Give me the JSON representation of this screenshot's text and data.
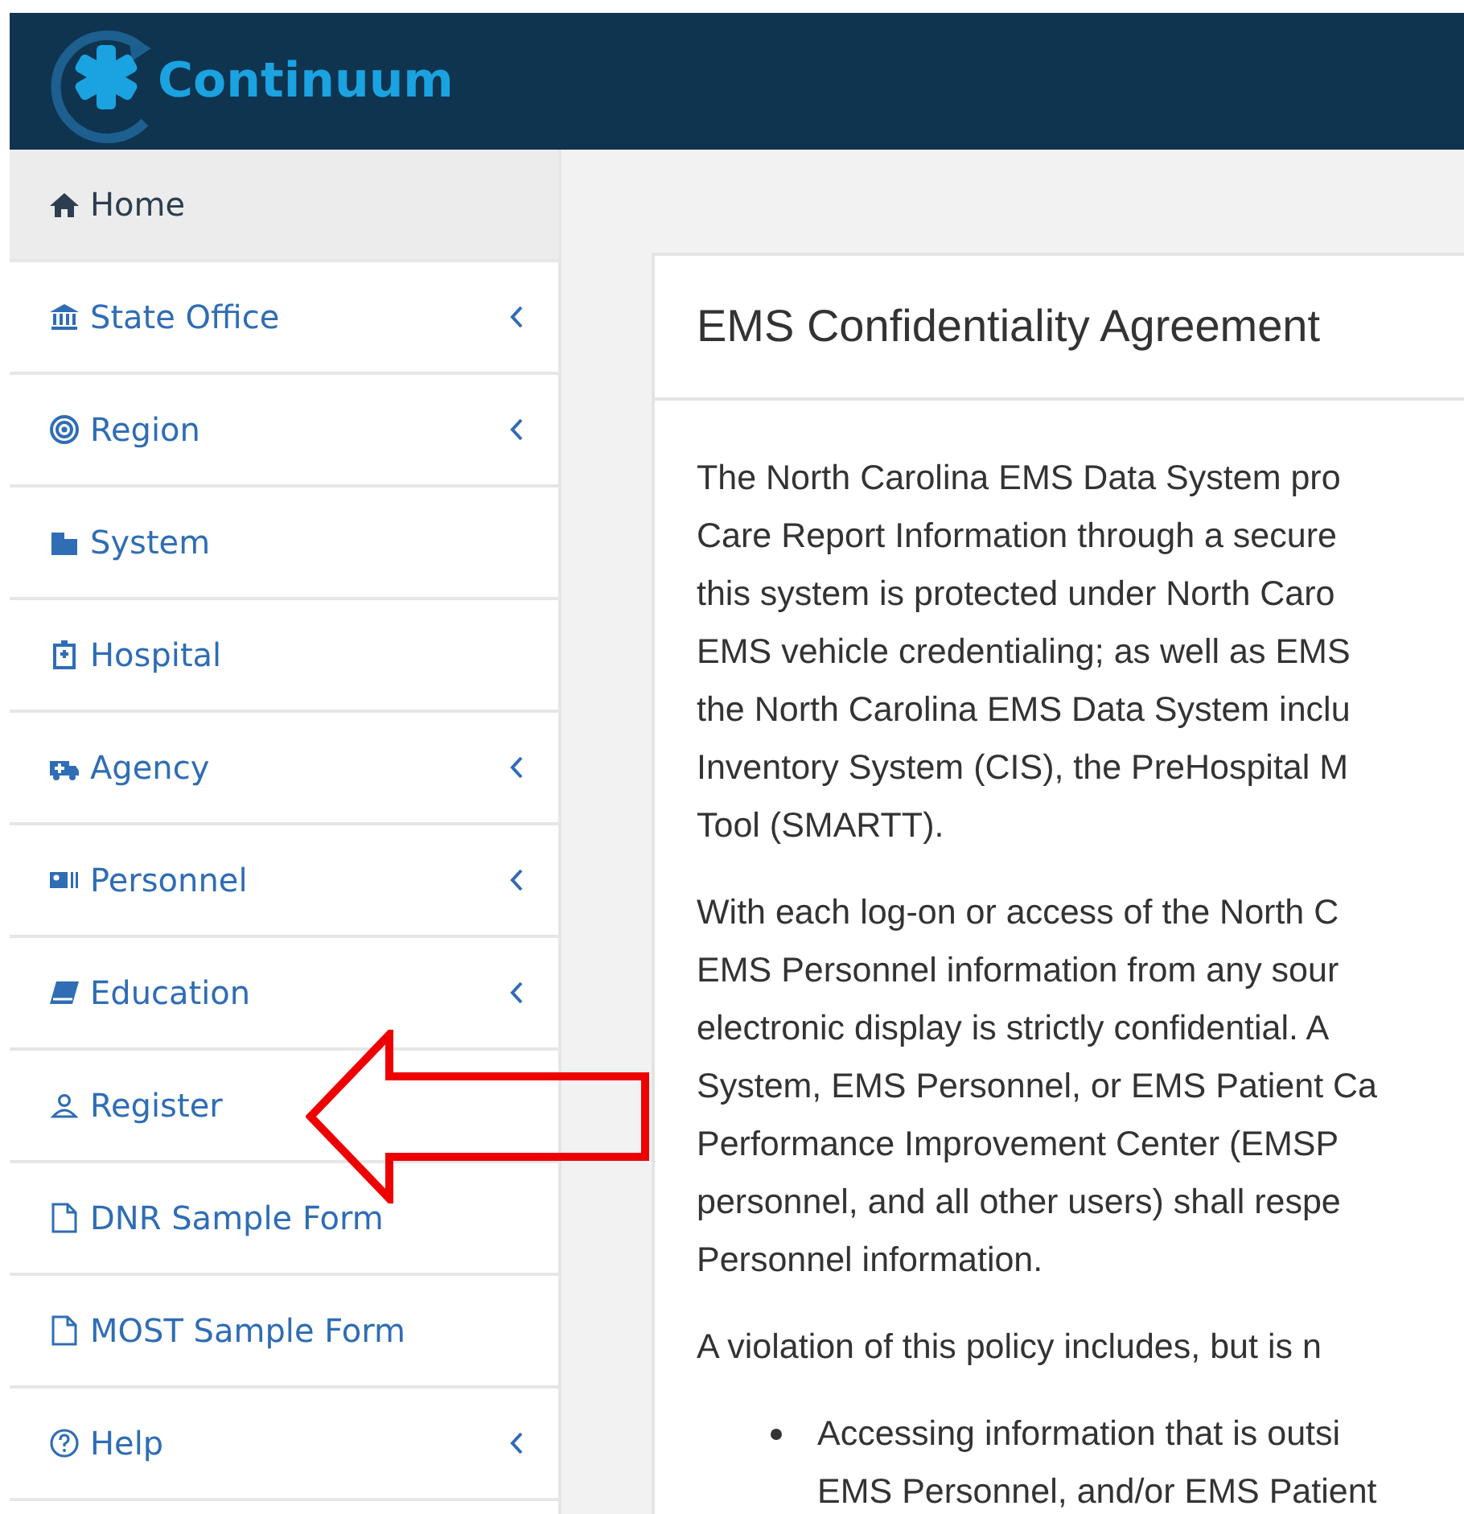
{
  "header": {
    "logo_text": "Continuum"
  },
  "sidebar": {
    "items": [
      {
        "label": "Home",
        "selected": true,
        "expandable": false
      },
      {
        "label": "State Office",
        "selected": false,
        "expandable": true
      },
      {
        "label": "Region",
        "selected": false,
        "expandable": true
      },
      {
        "label": "System",
        "selected": false,
        "expandable": false
      },
      {
        "label": "Hospital",
        "selected": false,
        "expandable": false
      },
      {
        "label": "Agency",
        "selected": false,
        "expandable": true
      },
      {
        "label": "Personnel",
        "selected": false,
        "expandable": true
      },
      {
        "label": "Education",
        "selected": false,
        "expandable": true
      },
      {
        "label": "Register",
        "selected": false,
        "expandable": false
      },
      {
        "label": "DNR Sample Form",
        "selected": false,
        "expandable": false
      },
      {
        "label": "MOST Sample Form",
        "selected": false,
        "expandable": false
      },
      {
        "label": "Help",
        "selected": false,
        "expandable": true
      }
    ]
  },
  "card": {
    "title": "EMS Confidentiality Agreement",
    "paragraphs": [
      [
        "The North Carolina EMS Data System pro",
        "Care Report Information through a secure",
        "this system is protected under North Caro",
        "EMS vehicle credentialing; as well as EMS",
        "the North Carolina EMS Data System inclu",
        "Inventory System (CIS), the PreHospital M",
        "Tool (SMARTT)."
      ],
      [
        "With each log-on or access of the North C",
        "EMS Personnel information from any sour",
        "electronic display is strictly confidential. A",
        "System, EMS Personnel, or EMS Patient Ca",
        "Performance Improvement Center (EMSP",
        "personnel, and all other users) shall respe",
        "Personnel information."
      ],
      [
        "A violation of this policy includes, but is n"
      ]
    ],
    "bullets": [
      [
        "Accessing information that is outsi",
        "EMS Personnel, and/or EMS Patient"
      ]
    ]
  }
}
